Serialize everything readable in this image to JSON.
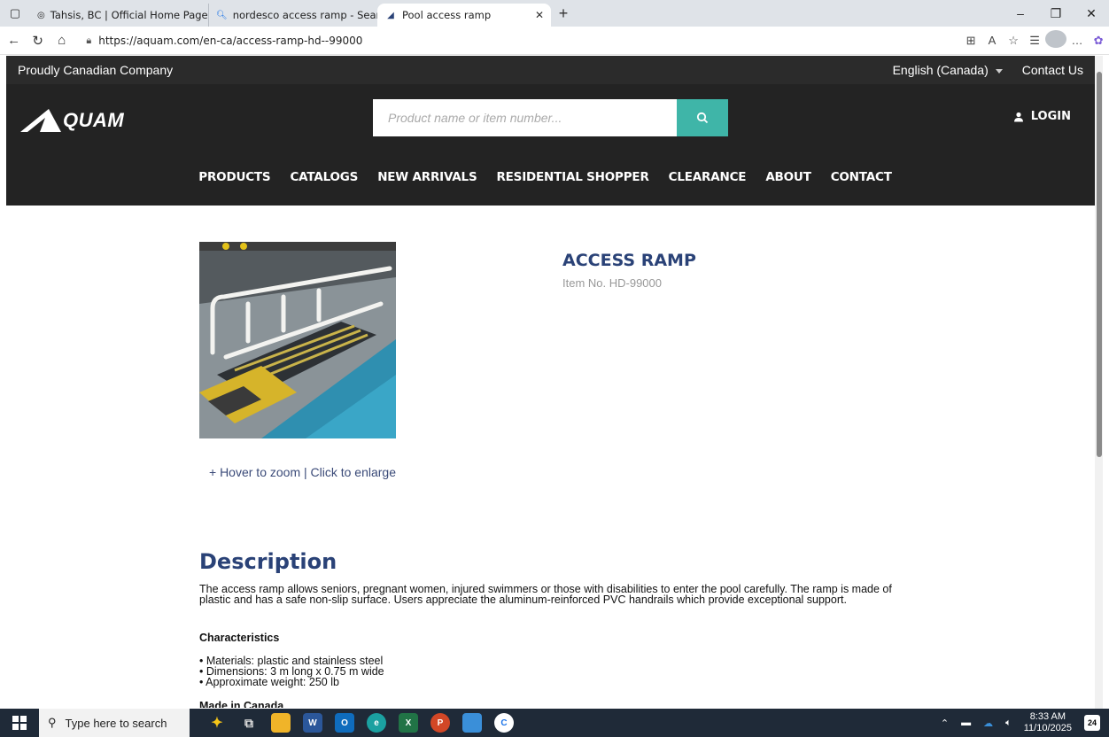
{
  "browser": {
    "tabs": [
      {
        "title": "Tahsis, BC | Official Home Page fo",
        "favicon": "globe-icon"
      },
      {
        "title": "nordesco access ramp - Search",
        "favicon": "search-icon"
      },
      {
        "title": "Pool access ramp",
        "favicon": "aquam-icon"
      }
    ],
    "url": "https://aquam.com/en-ca/access-ramp-hd--99000"
  },
  "site": {
    "top_strip": {
      "tagline": "Proudly Canadian Company",
      "language": "English (Canada)",
      "contact": "Contact Us"
    },
    "logo_text": "QUAM",
    "search": {
      "placeholder": "Product name or item number..."
    },
    "login_label": "LOGIN",
    "nav": [
      "PRODUCTS",
      "CATALOGS",
      "NEW ARRIVALS",
      "RESIDENTIAL SHOPPER",
      "CLEARANCE",
      "ABOUT",
      "CONTACT"
    ],
    "accent_color": "#3fb5a8",
    "heading_color": "#2a4277"
  },
  "product": {
    "title": "ACCESS RAMP",
    "item_no": "Item No. HD-99000",
    "zoom_hint": "+ Hover to zoom | Click to enlarge",
    "description_heading": "Description",
    "description": "The access ramp allows seniors, pregnant women, injured swimmers or those with disabilities to enter the pool carefully. The ramp is made of plastic and has a safe non-slip surface. Users appreciate the aluminum-reinforced PVC handrails which provide exceptional support.",
    "characteristics_heading": "Characteristics",
    "characteristics": [
      "• Materials: plastic and stainless steel",
      "• Dimensions: 3 m long x 0.75 m wide",
      "• Approximate weight: 250 lb"
    ],
    "made_in": "Made in Canada"
  },
  "taskbar": {
    "search_placeholder": "Type here to search",
    "time": "8:33 AM",
    "date": "11/10/2025",
    "notifications": "24"
  }
}
